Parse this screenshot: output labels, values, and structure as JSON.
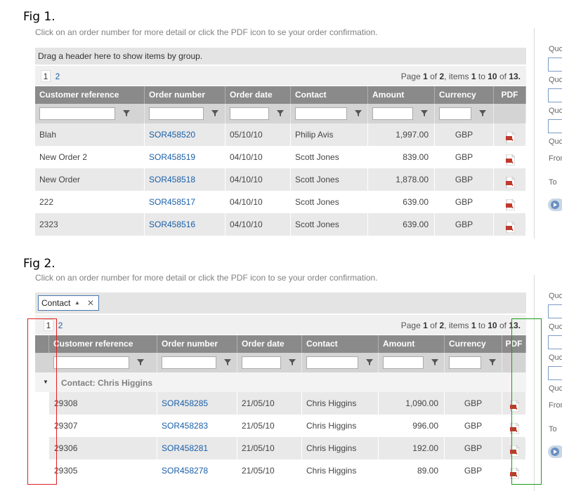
{
  "fig1": {
    "label": "Fig 1.",
    "instruction": "Click on an order number for more detail or click the PDF icon to se your order confirmation.",
    "group_hint": "Drag a header here to show items by group.",
    "pager": {
      "page1": "1",
      "page2": "2",
      "info_prefix": "Page",
      "page": "1",
      "of_word": "of",
      "pages": "2",
      "items_word": ", items",
      "from": "1",
      "to_word": "to",
      "to": "10",
      "total": "13."
    },
    "columns": [
      "Customer reference",
      "Order number",
      "Order date",
      "Contact",
      "Amount",
      "Currency",
      "PDF"
    ],
    "rows": [
      {
        "ref": "Blah",
        "order": "SOR458520",
        "date": "05/10/10",
        "contact": "Philip Avis",
        "amount": "1,997.00",
        "currency": "GBP"
      },
      {
        "ref": "New Order 2",
        "order": "SOR458519",
        "date": "04/10/10",
        "contact": "Scott Jones",
        "amount": "839.00",
        "currency": "GBP"
      },
      {
        "ref": "New Order",
        "order": "SOR458518",
        "date": "04/10/10",
        "contact": "Scott Jones",
        "amount": "1,878.00",
        "currency": "GBP"
      },
      {
        "ref": "222",
        "order": "SOR458517",
        "date": "04/10/10",
        "contact": "Scott Jones",
        "amount": "639.00",
        "currency": "GBP"
      },
      {
        "ref": "2323",
        "order": "SOR458516",
        "date": "04/10/10",
        "contact": "Scott Jones",
        "amount": "639.00",
        "currency": "GBP"
      }
    ],
    "side_labels": [
      "Quo",
      "Quo",
      "Quo",
      "Quo",
      "From",
      "To"
    ]
  },
  "fig2": {
    "label": "Fig 2.",
    "instruction": "Click on an order number for more detail or click the PDF icon to se your order confirmation.",
    "group_chip": "Contact",
    "pager": {
      "page1": "1",
      "page2": "2",
      "info_prefix": "Page",
      "page": "1",
      "of_word": "of",
      "pages": "2",
      "items_word": ", items",
      "from": "1",
      "to_word": "to",
      "to": "10",
      "total": "13."
    },
    "columns": [
      "Customer reference",
      "Order number",
      "Order date",
      "Contact",
      "Amount",
      "Currency",
      "PDF"
    ],
    "group_label": "Contact: Chris Higgins",
    "rows": [
      {
        "ref": "29308",
        "order": "SOR458285",
        "date": "21/05/10",
        "contact": "Chris Higgins",
        "amount": "1,090.00",
        "currency": "GBP"
      },
      {
        "ref": "29307",
        "order": "SOR458283",
        "date": "21/05/10",
        "contact": "Chris Higgins",
        "amount": "996.00",
        "currency": "GBP"
      },
      {
        "ref": "29306",
        "order": "SOR458281",
        "date": "21/05/10",
        "contact": "Chris Higgins",
        "amount": "192.00",
        "currency": "GBP"
      },
      {
        "ref": "29305",
        "order": "SOR458278",
        "date": "21/05/10",
        "contact": "Chris Higgins",
        "amount": "89.00",
        "currency": "GBP"
      }
    ],
    "side_labels": [
      "Quo",
      "Quo",
      "Quo",
      "Quo",
      "From",
      "To"
    ]
  },
  "colors": {
    "header_bg": "#8a8a8a",
    "link": "#1a5fa8",
    "highlight_red": "#e02020",
    "highlight_green": "#1a9a1a",
    "pdf_red": "#c0392b"
  }
}
